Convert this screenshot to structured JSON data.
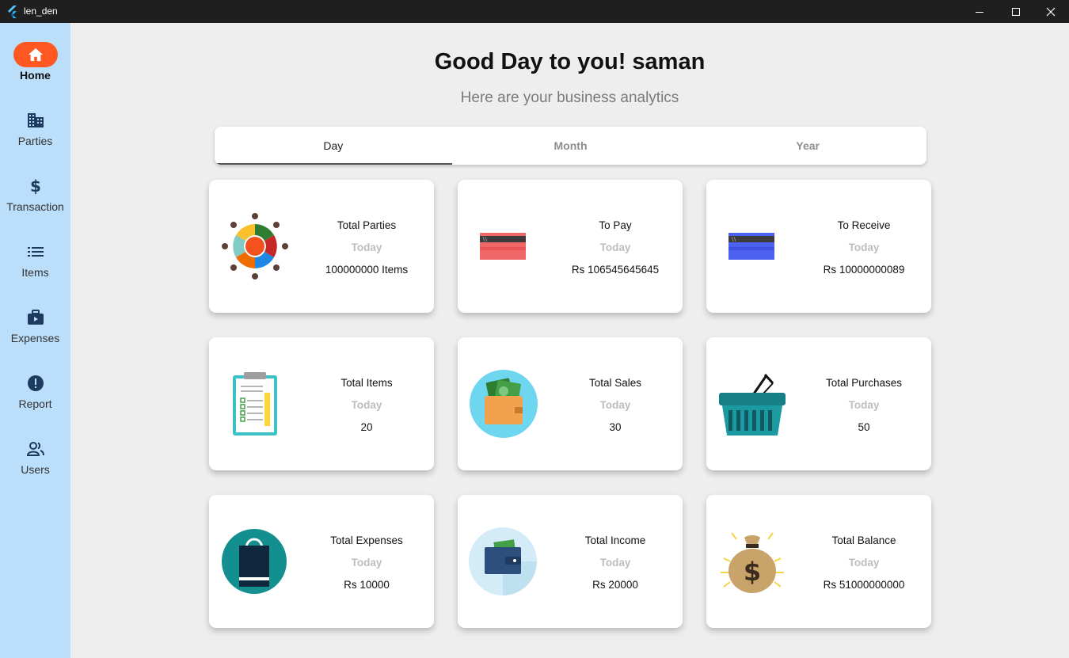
{
  "window": {
    "title": "len_den"
  },
  "sidebar": {
    "items": [
      {
        "label": "Home",
        "icon": "home-icon",
        "active": true
      },
      {
        "label": "Parties",
        "icon": "building-icon"
      },
      {
        "label": "Transaction",
        "icon": "dollar-icon"
      },
      {
        "label": "Items",
        "icon": "list-icon"
      },
      {
        "label": "Expenses",
        "icon": "briefcase-icon"
      },
      {
        "label": "Report",
        "icon": "alert-icon"
      },
      {
        "label": "Users",
        "icon": "users-icon"
      }
    ],
    "accent": "#ff5722",
    "background": "#bbdefb"
  },
  "main": {
    "greeting": "Good Day to you! saman",
    "subtitle": "Here are your business analytics",
    "tabs": [
      {
        "label": "Day",
        "active": true
      },
      {
        "label": "Month"
      },
      {
        "label": "Year"
      }
    ],
    "cards": [
      {
        "title": "Total Parties",
        "period": "Today",
        "value": "100000000 Items",
        "icon": "people-circle-icon"
      },
      {
        "title": "To Pay",
        "period": "Today",
        "value": "Rs 106545645645",
        "icon": "red-card-icon"
      },
      {
        "title": "To Receive",
        "period": "Today",
        "value": "Rs 10000000089",
        "icon": "blue-card-icon"
      },
      {
        "title": "Total Items",
        "period": "Today",
        "value": "20",
        "icon": "clipboard-icon"
      },
      {
        "title": "Total Sales",
        "period": "Today",
        "value": "30",
        "icon": "wallet-cash-icon"
      },
      {
        "title": "Total Purchases",
        "period": "Today",
        "value": "50",
        "icon": "basket-icon"
      },
      {
        "title": "Total Expenses",
        "period": "Today",
        "value": "Rs 10000",
        "icon": "shopping-bag-icon"
      },
      {
        "title": "Total Income",
        "period": "Today",
        "value": "Rs 20000",
        "icon": "wallet-icon"
      },
      {
        "title": "Total Balance",
        "period": "Today",
        "value": "Rs 51000000000",
        "icon": "money-bag-icon"
      }
    ]
  }
}
